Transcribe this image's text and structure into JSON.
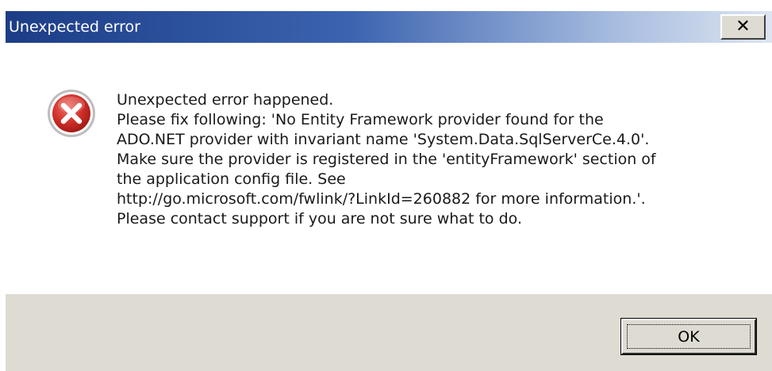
{
  "window": {
    "title": "Unexpected error",
    "close_glyph": "✕"
  },
  "icon": {
    "name": "error-icon",
    "color": "#c8221c"
  },
  "message": {
    "lines": [
      "Unexpected error happened.",
      "Please fix following: 'No Entity Framework provider found for the",
      "ADO.NET provider with invariant name 'System.Data.SqlServerCe.4.0'.",
      "Make sure the provider is registered in the 'entityFramework' section of",
      "the application config file. See",
      "http://go.microsoft.com/fwlink/?LinkId=260882 for more information.'.",
      "Please contact support if you are not sure what to do."
    ]
  },
  "buttons": {
    "ok_label": "OK"
  },
  "colors": {
    "title_dark": "#1c3d86",
    "title_light": "#dde5f1",
    "footer_bg": "#dedbd3"
  }
}
